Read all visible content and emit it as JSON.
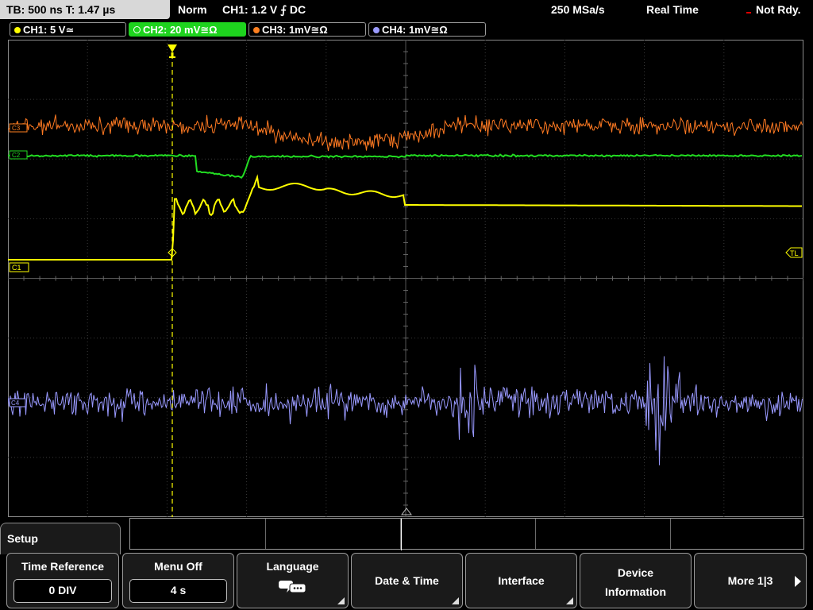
{
  "topbar": {
    "timebase": "TB: 500 ns   T: 1.47 µs",
    "trigger_mode": "Norm",
    "trigger_info": "CH1: 1.2 V ⨍ DC",
    "sample_rate": "250 MSa/s",
    "acq_mode": "Real Time",
    "status": "Not Rdy."
  },
  "channels": [
    {
      "label": "CH1: 5 V≃",
      "color": "#ffff00"
    },
    {
      "label": "CH2: 20 mV≅Ω",
      "color": "#22dd22"
    },
    {
      "label": "CH3: 1mV≅Ω",
      "color": "#ff8020"
    },
    {
      "label": "CH4: 1mV≅Ω",
      "color": "#9b9bff"
    }
  ],
  "screen": {
    "marker_c3": "C3",
    "marker_c2": "C2",
    "marker_c1": "C1",
    "marker_c4": "C4",
    "marker_tl": "TL"
  },
  "menu": {
    "tab_title": "Setup",
    "softkeys": [
      {
        "label": "Time Reference",
        "value": "0 DIV"
      },
      {
        "label": "Menu Off",
        "value": "4 s"
      },
      {
        "label": "Language",
        "icon": "speech-bubbles-icon"
      },
      {
        "label": "Date & Time"
      },
      {
        "label": "Interface"
      },
      {
        "label": "Device Information",
        "line1": "Device",
        "line2": "Information"
      },
      {
        "label": "More 1|3"
      }
    ]
  }
}
